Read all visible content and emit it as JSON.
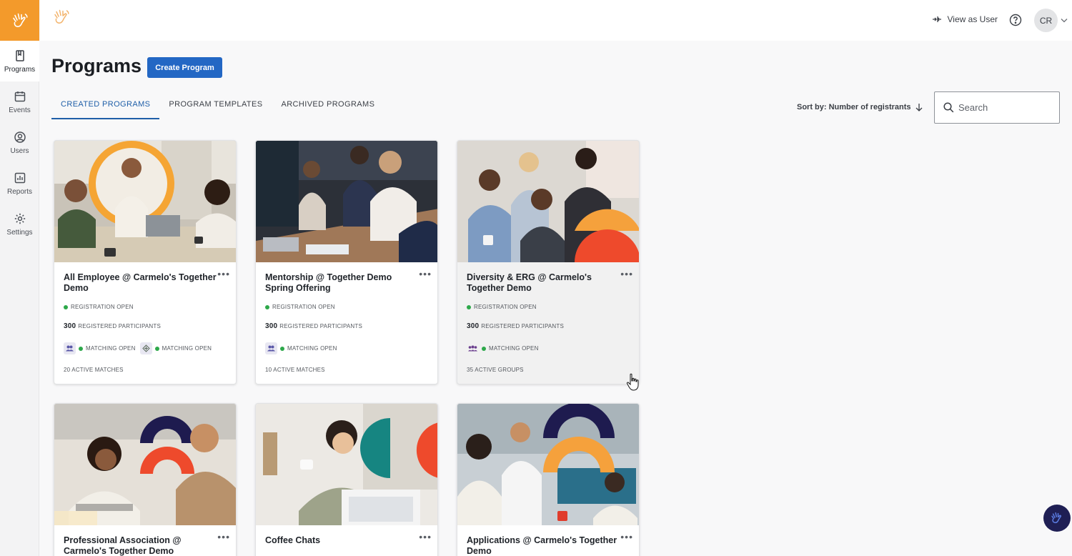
{
  "sidebar": {
    "items": [
      {
        "label": "Programs",
        "icon": "book-icon",
        "active": true
      },
      {
        "label": "Events",
        "icon": "calendar-icon",
        "active": false
      },
      {
        "label": "Users",
        "icon": "user-circle-icon",
        "active": false
      },
      {
        "label": "Reports",
        "icon": "bar-chart-icon",
        "active": false
      },
      {
        "label": "Settings",
        "icon": "gear-icon",
        "active": false
      }
    ]
  },
  "topbar": {
    "view_as_user": "View as User",
    "avatar_initials": "CR"
  },
  "header": {
    "title": "Programs",
    "create_button": "Create Program"
  },
  "tabs": [
    {
      "label": "CREATED PROGRAMS",
      "active": true
    },
    {
      "label": "PROGRAM TEMPLATES",
      "active": false
    },
    {
      "label": "ARCHIVED PROGRAMS",
      "active": false
    }
  ],
  "sort": {
    "label": "Sort by: Number of registrants"
  },
  "search": {
    "placeholder": "Search"
  },
  "colors": {
    "brand_orange": "#f39a2b",
    "primary_blue": "#2367c4",
    "status_green": "#2da84a",
    "navy": "#1f1f54",
    "accent_red": "#ee4a2c"
  },
  "programs": [
    {
      "title": "All Employee @ Carmelo's Together Demo",
      "status": "REGISTRATION OPEN",
      "participants_count": "300",
      "participants_label": "REGISTERED PARTICIPANTS",
      "matching": [
        "MATCHING OPEN",
        "MATCHING OPEN"
      ],
      "active_label": "20 ACTIVE MATCHES"
    },
    {
      "title": "Mentorship @ Together Demo Spring Offering",
      "status": "REGISTRATION OPEN",
      "participants_count": "300",
      "participants_label": "REGISTERED PARTICIPANTS",
      "matching": [
        "MATCHING OPEN"
      ],
      "active_label": "10 ACTIVE MATCHES"
    },
    {
      "title": "Diversity & ERG @ Carmelo's Together Demo",
      "status": "REGISTRATION OPEN",
      "participants_count": "300",
      "participants_label": "REGISTERED PARTICIPANTS",
      "matching": [
        "MATCHING OPEN"
      ],
      "active_label": "35 ACTIVE GROUPS"
    },
    {
      "title": "Professional Association @ Carmelo's Together Demo"
    },
    {
      "title": "Coffee Chats"
    },
    {
      "title": "Applications @ Carmelo's Together Demo"
    }
  ]
}
